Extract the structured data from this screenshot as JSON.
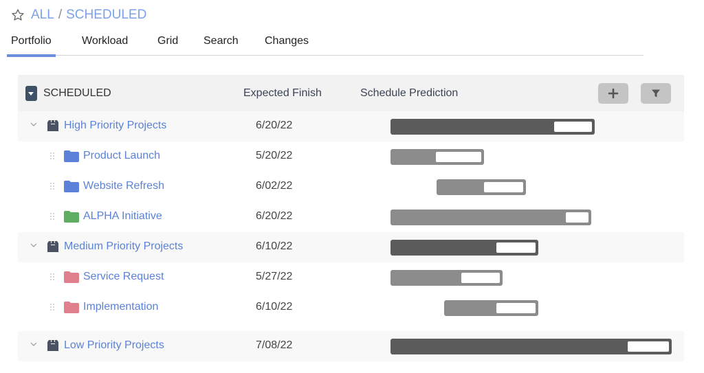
{
  "breadcrumb": {
    "root": "ALL",
    "separator": "/",
    "current": "SCHEDULED"
  },
  "tabs": [
    {
      "label": "Portfolio",
      "active": true
    },
    {
      "label": "Workload",
      "active": false
    },
    {
      "label": "Grid",
      "active": false
    },
    {
      "label": "Search",
      "active": false
    },
    {
      "label": "Changes",
      "active": false
    }
  ],
  "table": {
    "title": "SCHEDULED",
    "columns": {
      "expected_finish": "Expected Finish",
      "schedule_prediction": "Schedule Prediction"
    },
    "buttons": {
      "add": "add-icon",
      "filter": "filter-icon"
    },
    "colors": {
      "link": "#5b82d8",
      "group_bar": "#5b5b5b",
      "item_bar": "#8c8c8c"
    },
    "rows": [
      {
        "type": "group",
        "name": "High Priority Projects",
        "finish": "6/20/22",
        "bar": {
          "start": 0.0,
          "end": 0.727,
          "prediction_start": 0.581
        }
      },
      {
        "type": "item",
        "name": "Product Launch",
        "folder_color": "#5b82d8",
        "finish": "5/20/22",
        "bar": {
          "start": 0.0,
          "end": 0.333,
          "prediction_start": 0.162
        }
      },
      {
        "type": "item",
        "name": "Website Refresh",
        "folder_color": "#5b82d8",
        "finish": "6/02/22",
        "bar": {
          "start": 0.164,
          "end": 0.482,
          "prediction_start": 0.333
        }
      },
      {
        "type": "item",
        "name": "ALPHA Initiative",
        "folder_color": "#5fae63",
        "finish": "6/20/22",
        "bar": {
          "start": 0.0,
          "end": 0.714,
          "prediction_start": 0.623
        }
      },
      {
        "type": "group",
        "name": "Medium Priority Projects",
        "finish": "6/10/22",
        "bar": {
          "start": 0.0,
          "end": 0.526,
          "prediction_start": 0.377
        }
      },
      {
        "type": "item",
        "name": "Service Request",
        "folder_color": "#e0808f",
        "finish": "5/27/22",
        "bar": {
          "start": 0.0,
          "end": 0.399,
          "prediction_start": 0.252
        }
      },
      {
        "type": "item",
        "name": "Implementation",
        "folder_color": "#e0808f",
        "finish": "6/10/22",
        "bar": {
          "start": 0.191,
          "end": 0.526,
          "prediction_start": 0.377
        }
      },
      {
        "type": "group",
        "name": "Low Priority Projects",
        "finish": "7/08/22",
        "bar": {
          "start": 0.0,
          "end": 1.0,
          "prediction_start": 0.844
        }
      }
    ]
  }
}
